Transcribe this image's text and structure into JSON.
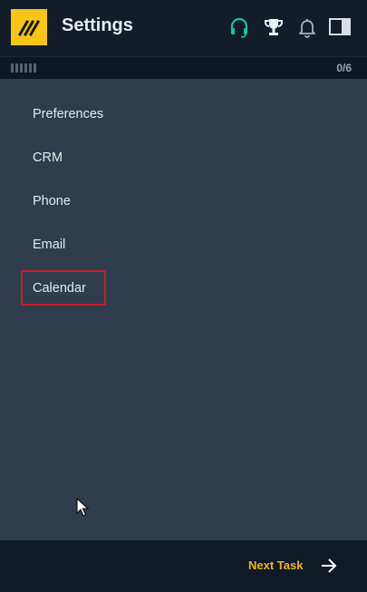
{
  "header": {
    "title": "Settings"
  },
  "icons": {
    "logo": "logo-icon",
    "headset": "headset-icon",
    "trophy": "trophy-icon",
    "bell": "bell-icon",
    "layout": "panel-toggle-icon"
  },
  "progress": {
    "count": "0/6"
  },
  "menu": {
    "items": [
      {
        "label": "Preferences"
      },
      {
        "label": "CRM"
      },
      {
        "label": "Phone"
      },
      {
        "label": "Email"
      },
      {
        "label": "Calendar"
      }
    ],
    "selected": "Calendar"
  },
  "footer": {
    "next_label": "Next Task"
  },
  "colors": {
    "accent_yellow": "#f5c518",
    "headset_teal": "#19c2a8",
    "next_label": "#f0b429",
    "selection_border": "#c0202a"
  }
}
